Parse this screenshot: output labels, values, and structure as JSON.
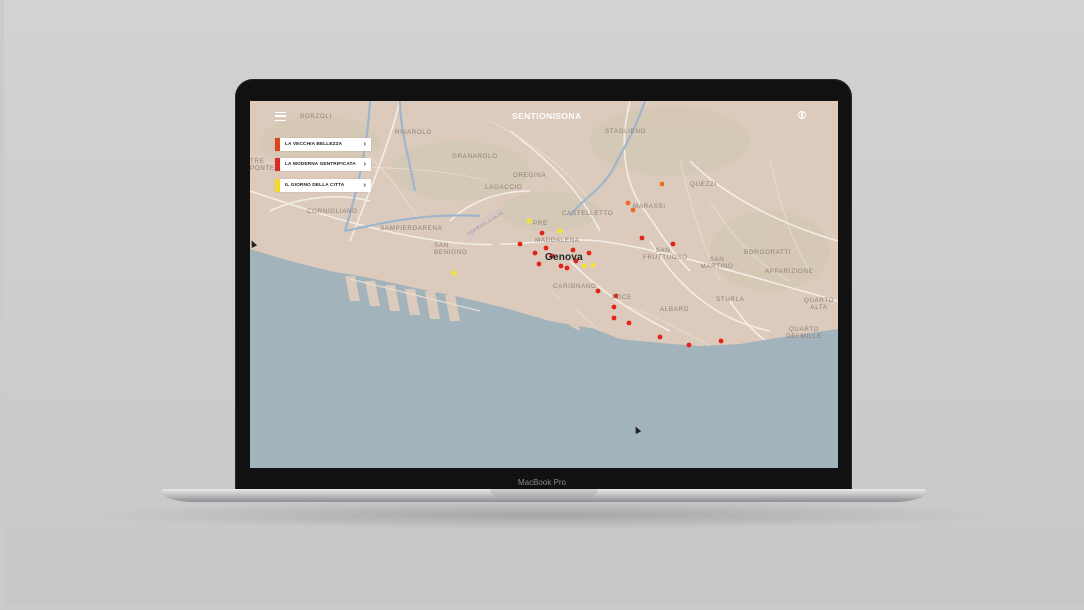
{
  "device": {
    "model_label": "MacBook Pro"
  },
  "app": {
    "brand": "SENTIONISONA",
    "menu_icon": "hamburger-icon",
    "language_icon": "globe-icon",
    "layers": [
      {
        "label": "LA VECCHIA BELLEZZA",
        "color": "#e0431f"
      },
      {
        "label": "LA MODERNA GENTRIFICATA",
        "color": "#d92b22"
      },
      {
        "label": "IL GIORNO DELLA CITTA",
        "color": "#f4dc25"
      }
    ]
  },
  "map": {
    "city_label": "Genova",
    "place_labels": [
      "BORZOLI",
      "RIVAROLO",
      "STAGLIENO",
      "GRANAROLO",
      "OREGINA",
      "LAGACCIO",
      "QUEZZI",
      "CORNIGLIANO",
      "SAMPIERDARENA",
      "CASTELLETTO",
      "MARASSI",
      "SAN BENIGNO",
      "PRE",
      "MADDALENA",
      "SAN FRUTTUOSO",
      "BORGORATTI",
      "SAN MARTINO",
      "APPARIZIONE",
      "CARIGNANO",
      "FOCE",
      "STURLA",
      "QUARTO ALTA",
      "ALBARO",
      "QUARTO DEI MILLE",
      "TRE PONTE"
    ],
    "road_label": "SOPRAELEVATA",
    "colors": {
      "land": "#dccbbd",
      "sea": "#a3b3bc",
      "roads": "#f2ece6",
      "greenery": "#cfc9b6"
    },
    "markers": [
      {
        "color": "red"
      },
      {
        "color": "red"
      },
      {
        "color": "red"
      },
      {
        "color": "red"
      },
      {
        "color": "red"
      },
      {
        "color": "red"
      },
      {
        "color": "red"
      },
      {
        "color": "red"
      },
      {
        "color": "red"
      },
      {
        "color": "red"
      },
      {
        "color": "red"
      },
      {
        "color": "red"
      },
      {
        "color": "red"
      },
      {
        "color": "red"
      },
      {
        "color": "red"
      },
      {
        "color": "red"
      },
      {
        "color": "red"
      },
      {
        "color": "red"
      },
      {
        "color": "red"
      },
      {
        "color": "red"
      },
      {
        "color": "red"
      },
      {
        "color": "orange"
      },
      {
        "color": "orange"
      },
      {
        "color": "orange"
      },
      {
        "color": "yellow"
      },
      {
        "color": "yellow"
      },
      {
        "color": "yellow"
      },
      {
        "color": "yellow"
      },
      {
        "color": "yellow"
      }
    ]
  }
}
